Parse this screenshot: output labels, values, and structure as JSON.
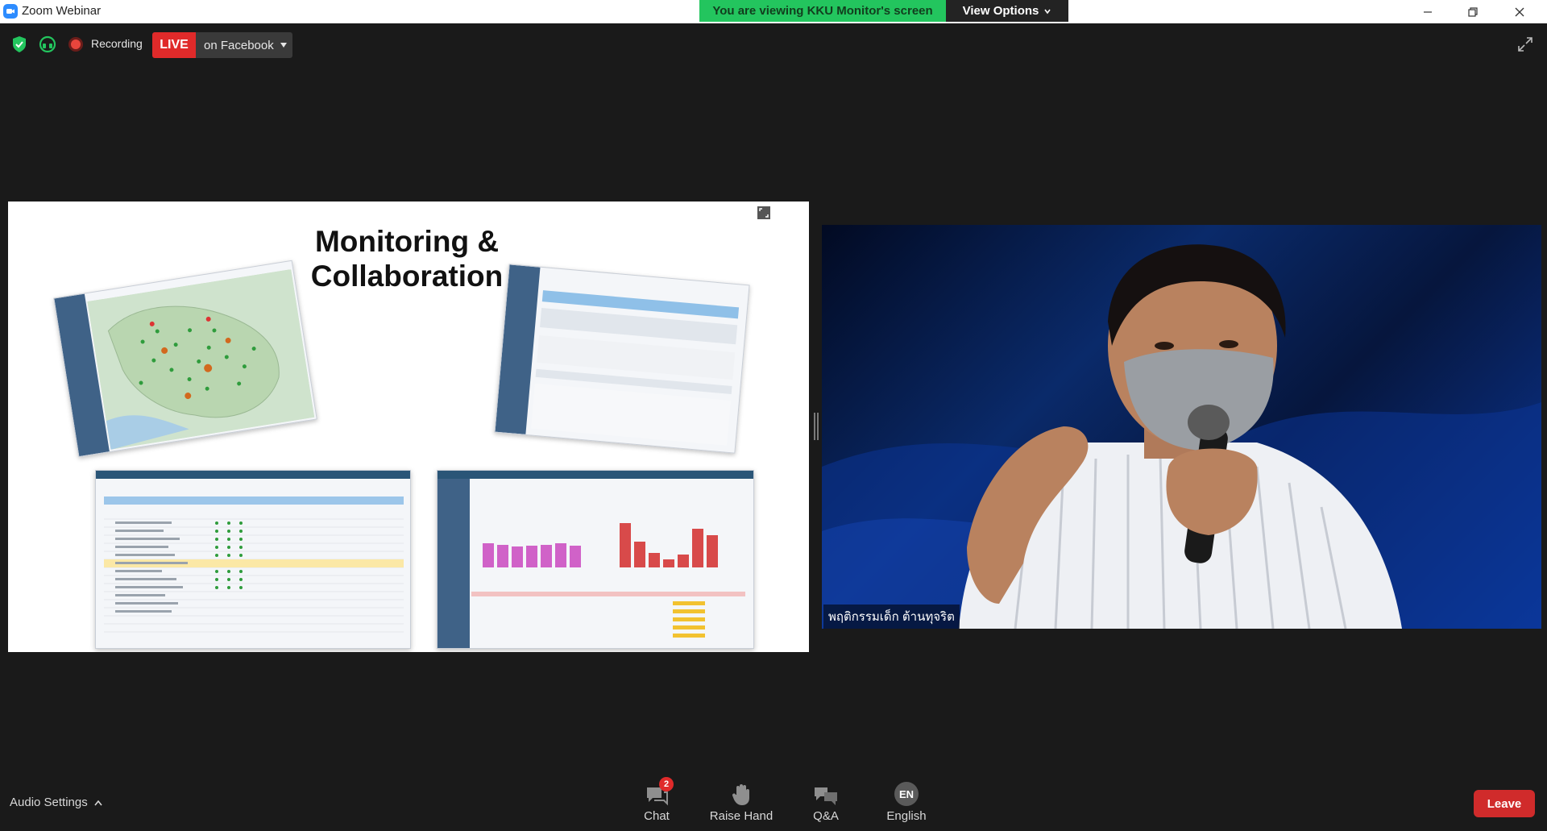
{
  "window": {
    "title": "Zoom Webinar",
    "viewing_banner": "You are viewing KKU Monitor's screen",
    "view_options_label": "View Options"
  },
  "status": {
    "recording_label": "Recording",
    "live_badge": "LIVE",
    "live_destination": "on Facebook"
  },
  "slide": {
    "title_line1": "Monitoring &",
    "title_line2": "Collaboration"
  },
  "video": {
    "participant_name": "พฤติกรรมเด็ก ต้านทุจริต"
  },
  "toolbar": {
    "audio_settings_label": "Audio Settings",
    "chat_label": "Chat",
    "chat_unread": "2",
    "raise_hand_label": "Raise Hand",
    "qa_label": "Q&A",
    "language_code": "EN",
    "language_label": "English",
    "leave_label": "Leave"
  },
  "colors": {
    "live_red": "#e02a2a",
    "banner_green": "#23c55e",
    "leave_red": "#d02b2b",
    "zoom_blue": "#2d8cff"
  }
}
